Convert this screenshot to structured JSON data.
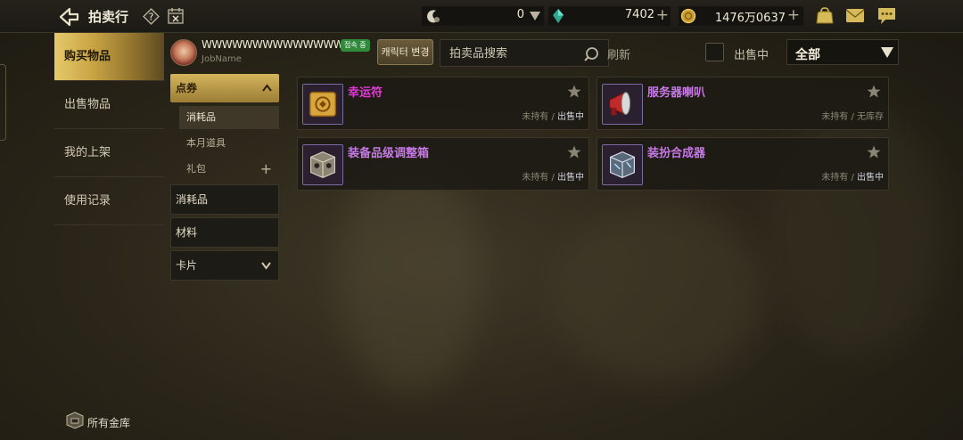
{
  "header": {
    "title": "拍卖行",
    "currency_a_value": "0",
    "currency_b_value": "7402",
    "currency_c_value": "1476万0637"
  },
  "sidebar": {
    "items": [
      {
        "label": "购买物品",
        "active": true
      },
      {
        "label": "出售物品",
        "active": false
      },
      {
        "label": "我的上架",
        "active": false
      },
      {
        "label": "使用记录",
        "active": false
      }
    ],
    "vault_label": "所有金库"
  },
  "profile": {
    "name": "WWWWWWWWWWWWWW",
    "online_badge": "접속 중",
    "job": "JobName",
    "change_button": "캐릭터 변경"
  },
  "search": {
    "placeholder": "拍卖品搜索",
    "refresh_label": "刷新"
  },
  "filter": {
    "onsale_label": "出售中",
    "selected": "全部"
  },
  "categories": {
    "open": "点券",
    "sub": [
      {
        "label": "消耗品",
        "active": true
      },
      {
        "label": "本月道具",
        "active": false
      },
      {
        "label": "礼包",
        "active": false
      }
    ],
    "others": [
      "消耗品",
      "材料",
      "卡片"
    ]
  },
  "items": [
    {
      "name": "幸运符",
      "name_color": "#e23ad8",
      "owned": "未持有",
      "stock": "出售中",
      "icon": "scroll-icon"
    },
    {
      "name": "服务器喇叭",
      "name_color": "#c879e8",
      "owned": "未持有",
      "stock": "无库存",
      "icon": "megaphone-icon"
    },
    {
      "name": "装备品级调整箱",
      "name_color": "#c879e8",
      "owned": "未持有",
      "stock": "出售中",
      "icon": "box-icon"
    },
    {
      "name": "装扮合成器",
      "name_color": "#c879e8",
      "owned": "未持有",
      "stock": "出售中",
      "icon": "cube-icon"
    }
  ],
  "colors": {
    "accent_gold": "#d4b55c",
    "online_green": "#2f8a3a"
  }
}
